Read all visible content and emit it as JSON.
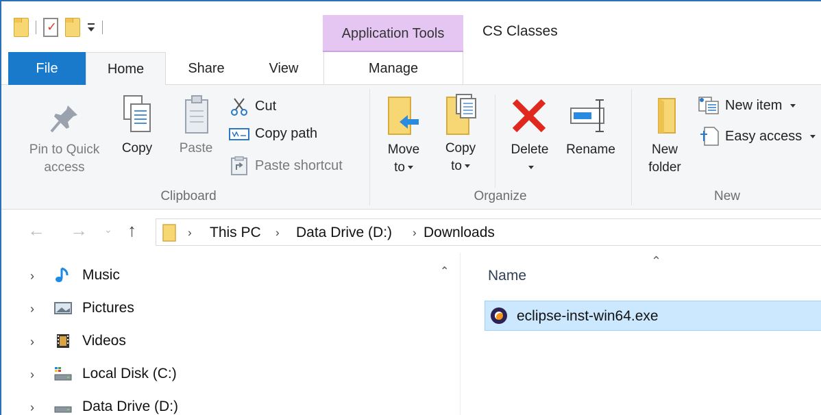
{
  "title_bar": {
    "contextual_tab": "Application Tools",
    "window_title": "CS Classes"
  },
  "tabs": {
    "file": "File",
    "home": "Home",
    "share": "Share",
    "view": "View",
    "manage": "Manage"
  },
  "ribbon": {
    "clipboard": {
      "group_label": "Clipboard",
      "pin_line1": "Pin to Quick",
      "pin_line2": "access",
      "copy": "Copy",
      "paste": "Paste",
      "cut": "Cut",
      "copy_path": "Copy path",
      "paste_shortcut": "Paste shortcut"
    },
    "organize": {
      "group_label": "Organize",
      "move_line1": "Move",
      "move_line2": "to",
      "copy_line1": "Copy",
      "copy_line2": "to",
      "delete": "Delete",
      "rename": "Rename"
    },
    "new": {
      "group_label": "New",
      "new_folder_line1": "New",
      "new_folder_line2": "folder",
      "new_item": "New item",
      "easy_access": "Easy access"
    }
  },
  "address": {
    "crumbs": [
      "This PC",
      "Data Drive (D:)",
      "Downloads"
    ]
  },
  "nav_pane": {
    "items": [
      {
        "label": "Music",
        "icon": "music-icon"
      },
      {
        "label": "Pictures",
        "icon": "pictures-icon"
      },
      {
        "label": "Videos",
        "icon": "videos-icon"
      },
      {
        "label": "Local Disk (C:)",
        "icon": "local-disk-icon"
      },
      {
        "label": "Data Drive (D:)",
        "icon": "drive-icon"
      }
    ]
  },
  "content": {
    "column_name": "Name",
    "files": [
      {
        "name": "eclipse-inst-win64.exe",
        "icon": "eclipse-installer-icon",
        "selected": true
      }
    ]
  },
  "colors": {
    "file_tab": "#1979ca",
    "contextual_tab": "#e5c6f3",
    "selection": "#cce8ff",
    "delete_red": "#e0281e",
    "folder_yellow": "#f7d674"
  }
}
